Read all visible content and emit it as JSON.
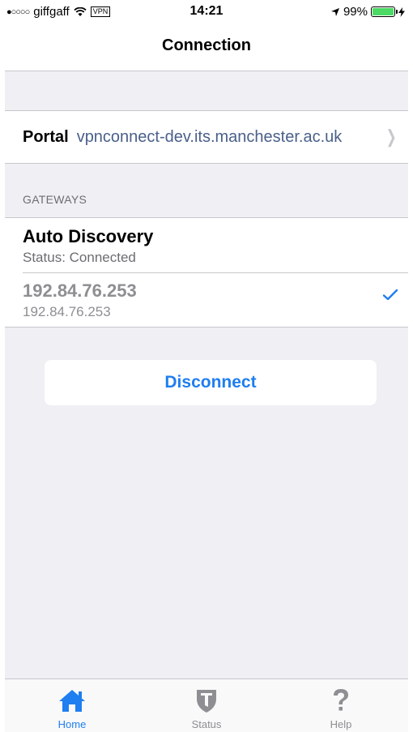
{
  "status_bar": {
    "signal": "●○○○○",
    "carrier": "giffgaff",
    "vpn": "VPN",
    "time": "14:21",
    "battery": "99%",
    "battery_level": 0.99
  },
  "nav": {
    "title": "Connection"
  },
  "portal": {
    "label": "Portal",
    "value": "vpnconnect-dev.its.manchester.ac.uk"
  },
  "gateways": {
    "header": "GATEWAYS",
    "items": [
      {
        "title": "Auto Discovery",
        "subtitle": "Status: Connected"
      },
      {
        "title": "192.84.76.253",
        "subtitle": "192.84.76.253"
      }
    ]
  },
  "actions": {
    "disconnect_label": "Disconnect"
  },
  "tabs": [
    {
      "label": "Home",
      "icon": "home-icon"
    },
    {
      "label": "Status",
      "icon": "shield-icon"
    },
    {
      "label": "Help",
      "icon": "help-icon"
    }
  ],
  "colors": {
    "accent": "#1f7ef0",
    "battery": "#4cd964",
    "portal_text": "#4a5f8a"
  }
}
